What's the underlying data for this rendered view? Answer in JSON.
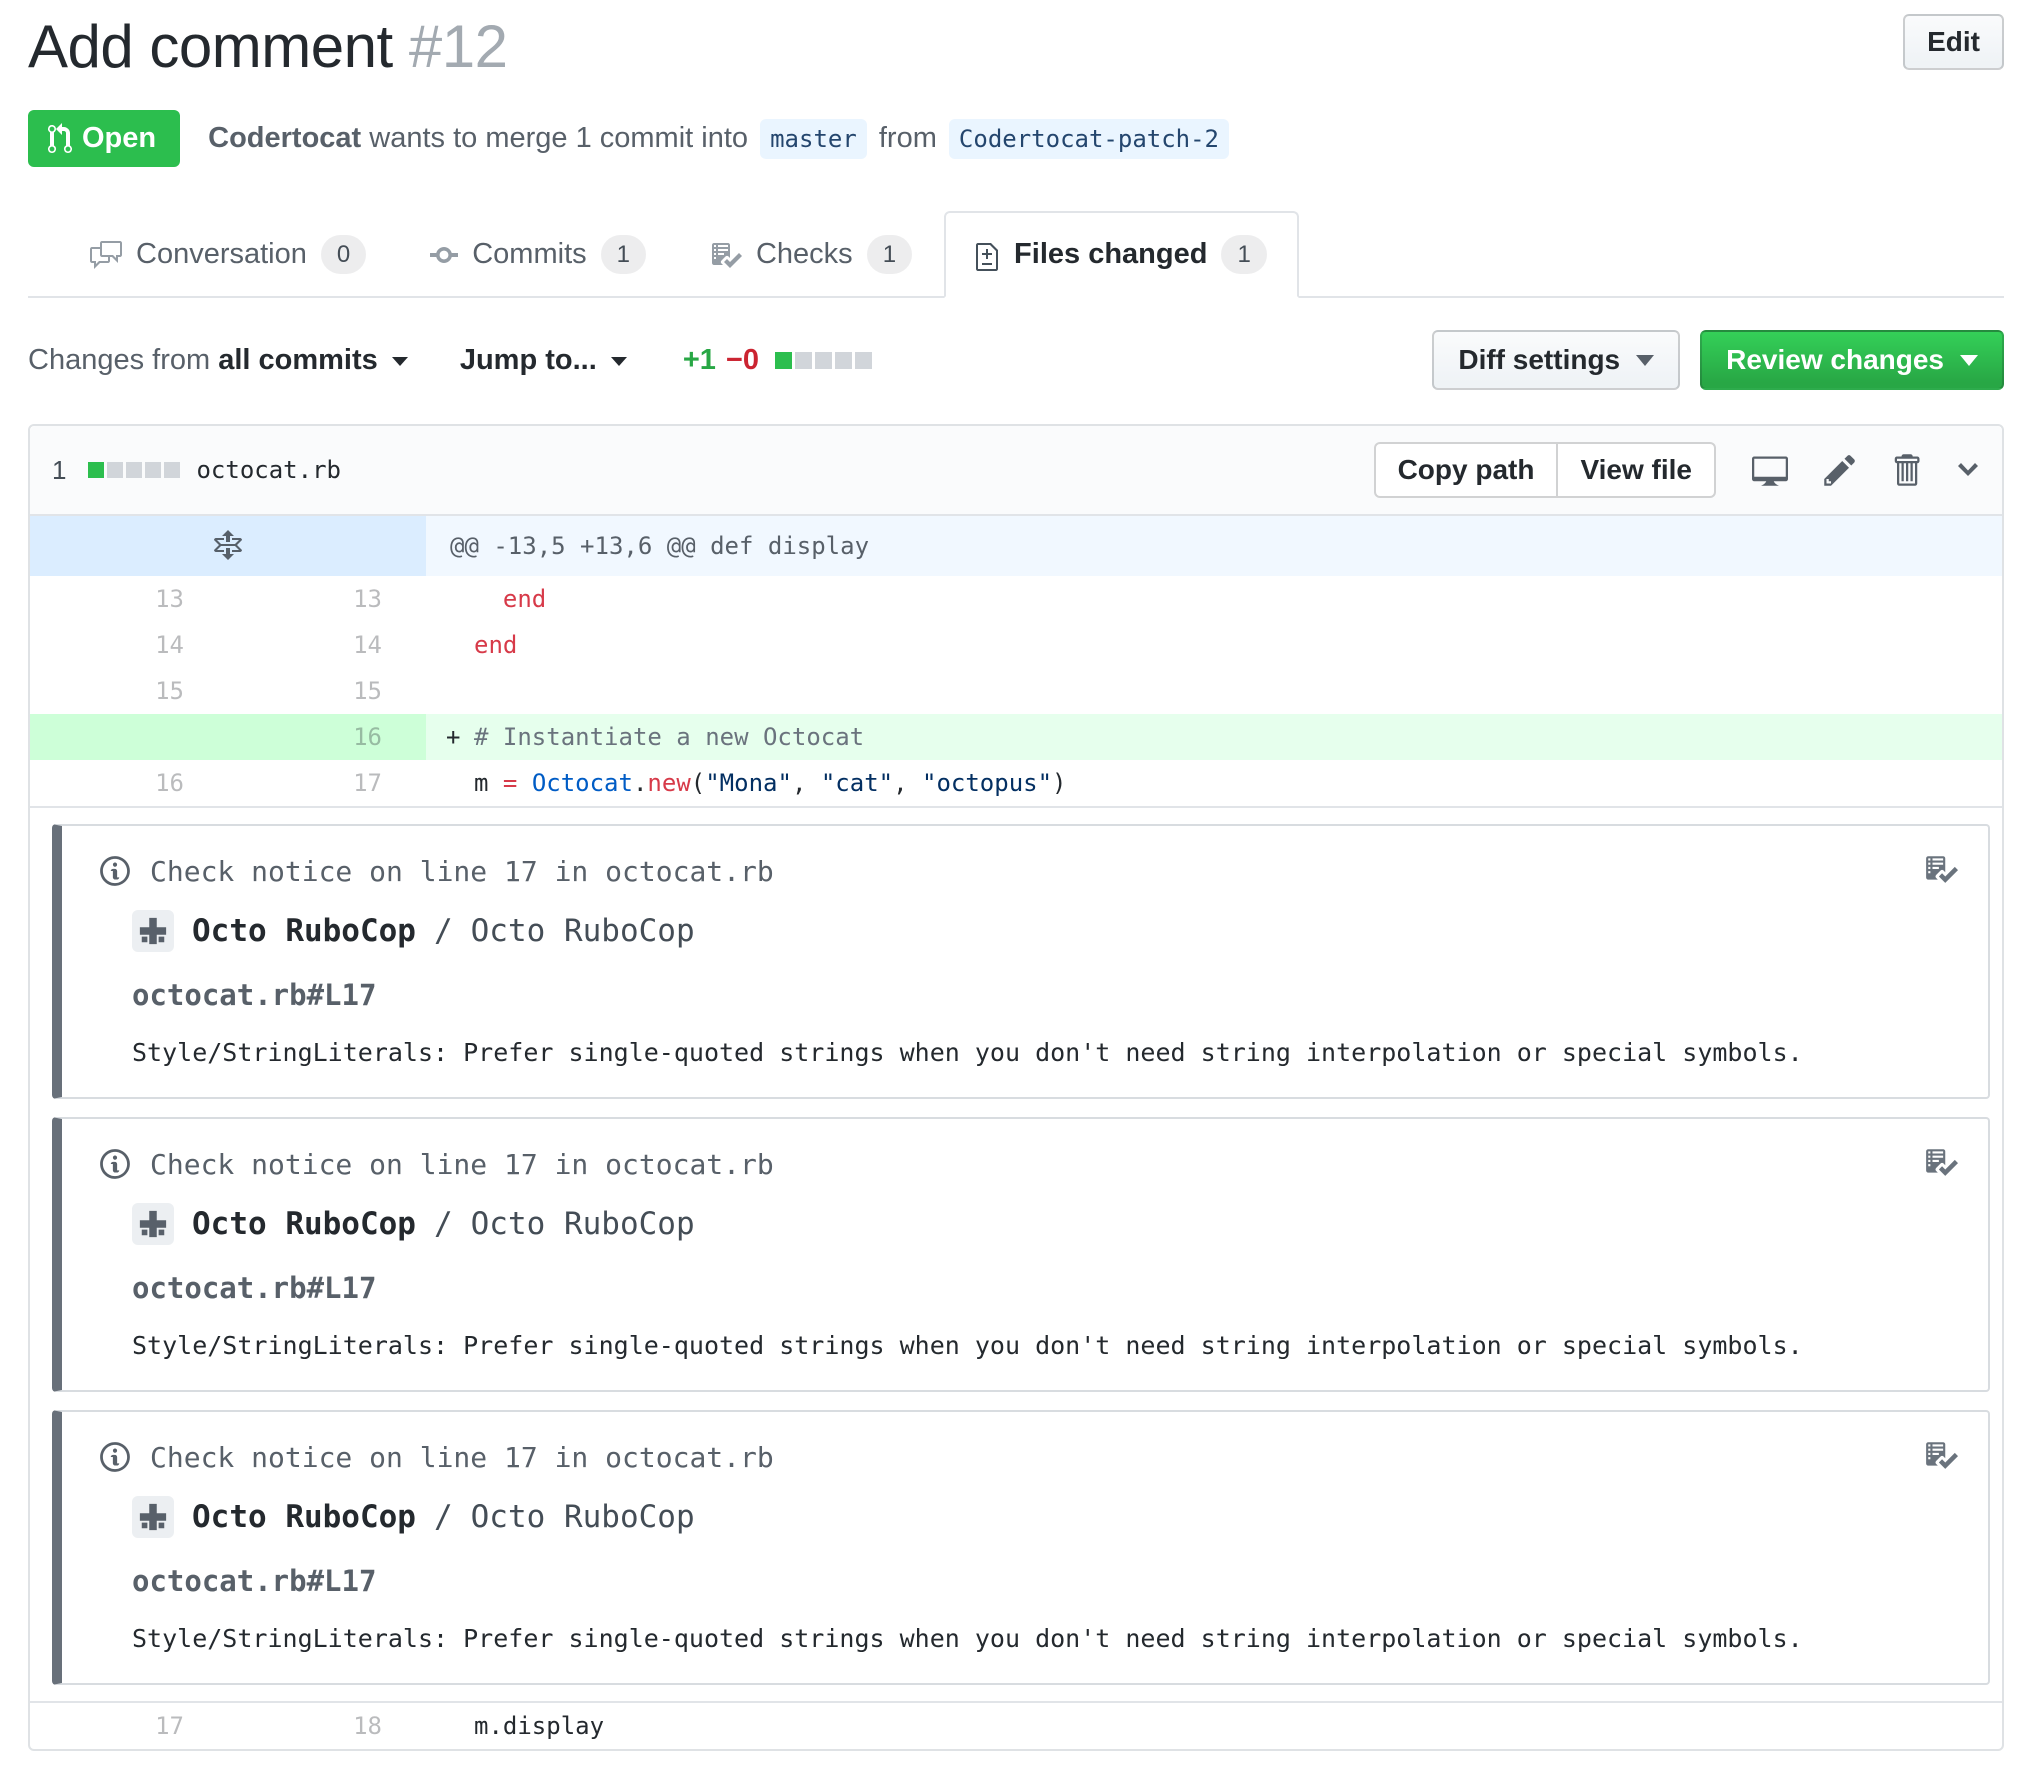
{
  "page": {
    "title": "Add comment",
    "number": "#12",
    "edit_label": "Edit"
  },
  "status": {
    "label": "Open",
    "color": "#2cbe4e"
  },
  "byline": {
    "author": "Codertocat",
    "action": "wants to merge 1 commit into",
    "base_branch": "master",
    "from_word": "from",
    "head_branch": "Codertocat-patch-2"
  },
  "tabs": [
    {
      "label": "Conversation",
      "count": "0",
      "icon": "comment-discussion-icon",
      "active": false
    },
    {
      "label": "Commits",
      "count": "1",
      "icon": "git-commit-icon",
      "active": false
    },
    {
      "label": "Checks",
      "count": "1",
      "icon": "checklist-icon",
      "active": false
    },
    {
      "label": "Files changed",
      "count": "1",
      "icon": "file-diff-icon",
      "active": true
    }
  ],
  "toolbar": {
    "changes_from_label": "Changes from",
    "changes_from_value": "all commits",
    "jump_to_label": "Jump to...",
    "additions": "+1",
    "deletions": "−0",
    "diffstat_blocks": [
      "green",
      "gray",
      "gray",
      "gray",
      "gray"
    ],
    "diff_settings_label": "Diff settings",
    "review_changes_label": "Review changes"
  },
  "file": {
    "changes_count": "1",
    "diffstat_blocks": [
      "green",
      "gray",
      "gray",
      "gray",
      "gray"
    ],
    "name": "octocat.rb",
    "copy_path_label": "Copy path",
    "view_file_label": "View file",
    "header_icons": [
      "display-icon",
      "pencil-icon",
      "trash-icon",
      "chevron-down-icon"
    ]
  },
  "diff": {
    "hunk_header": "@@ -13,5 +13,6 @@ def display",
    "rows": [
      {
        "old": "13",
        "new": "13",
        "sign": "",
        "added": false,
        "tokens": [
          {
            "t": "  "
          },
          {
            "t": "end",
            "c": "k"
          }
        ]
      },
      {
        "old": "14",
        "new": "14",
        "sign": "",
        "added": false,
        "tokens": [
          {
            "t": "end",
            "c": "k"
          }
        ]
      },
      {
        "old": "15",
        "new": "15",
        "sign": "",
        "added": false,
        "tokens": []
      },
      {
        "old": "",
        "new": "16",
        "sign": "+",
        "added": true,
        "tokens": [
          {
            "t": "# Instantiate a new Octocat",
            "c": "c"
          }
        ]
      },
      {
        "old": "16",
        "new": "17",
        "sign": "",
        "added": false,
        "tokens": [
          {
            "t": "m "
          },
          {
            "t": "=",
            "c": "k"
          },
          {
            "t": " "
          },
          {
            "t": "Octocat",
            "c": "v"
          },
          {
            "t": "."
          },
          {
            "t": "new",
            "c": "k"
          },
          {
            "t": "("
          },
          {
            "t": "\"Mona\"",
            "c": "s"
          },
          {
            "t": ", "
          },
          {
            "t": "\"cat\"",
            "c": "s"
          },
          {
            "t": ", "
          },
          {
            "t": "\"octopus\"",
            "c": "s"
          },
          {
            "t": ")"
          }
        ]
      }
    ],
    "trailing_row": {
      "old": "17",
      "new": "18",
      "sign": "",
      "added": false,
      "tokens": [
        {
          "t": "m.display"
        }
      ]
    }
  },
  "notices": [
    {
      "header": "Check notice on line 17 in octocat.rb",
      "app_name": "Octo RuboCop",
      "separator": "/",
      "context": "Octo RuboCop",
      "file_link": "octocat.rb#L17",
      "message": "Style/StringLiterals: Prefer single-quoted strings when you don't need string interpolation or special symbols."
    },
    {
      "header": "Check notice on line 17 in octocat.rb",
      "app_name": "Octo RuboCop",
      "separator": "/",
      "context": "Octo RuboCop",
      "file_link": "octocat.rb#L17",
      "message": "Style/StringLiterals: Prefer single-quoted strings when you don't need string interpolation or special symbols."
    },
    {
      "header": "Check notice on line 17 in octocat.rb",
      "app_name": "Octo RuboCop",
      "separator": "/",
      "context": "Octo RuboCop",
      "file_link": "octocat.rb#L17",
      "message": "Style/StringLiterals: Prefer single-quoted strings when you don't need string interpolation or special symbols."
    }
  ],
  "icons": [
    "git-pull-request-icon",
    "comment-discussion-icon",
    "git-commit-icon",
    "checklist-icon",
    "file-diff-icon",
    "unfold-icon",
    "display-icon",
    "pencil-icon",
    "trash-icon",
    "chevron-down-icon",
    "info-icon",
    "check-run-icon",
    "plus-avatar-icon"
  ],
  "colors": {
    "open_badge": "#2cbe4e",
    "primary_button": "#28a745",
    "added_line_bg": "#e6ffed",
    "added_gutter_bg": "#cdffd8",
    "hunk_line_bg": "#f1f8ff",
    "hunk_gutter_bg": "#dbedff",
    "keyword": "#d73a49",
    "constant": "#005cc5",
    "string": "#032f62",
    "comment": "#6a737d",
    "branch_chip_bg": "#eaf5ff"
  }
}
